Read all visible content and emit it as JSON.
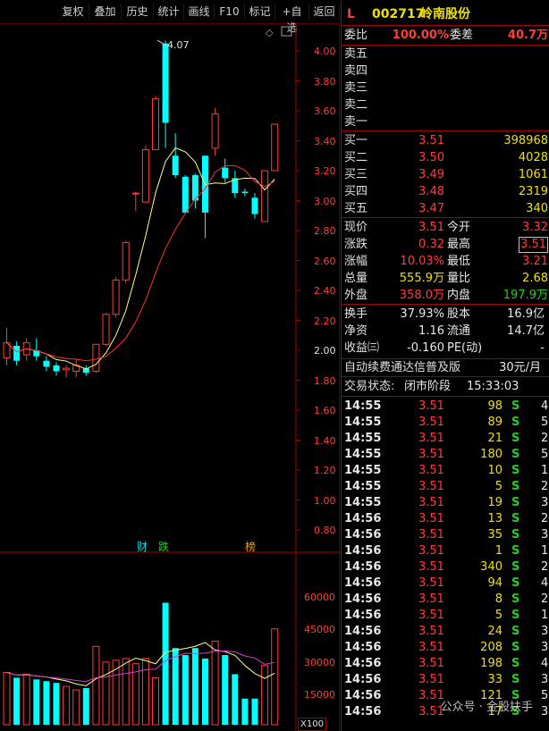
{
  "toolbar": {
    "items": [
      "复权",
      "叠加",
      "历史",
      "统计",
      "画线",
      "F10",
      "标记",
      "+自选",
      "返回"
    ]
  },
  "chart": {
    "price_labels": [
      "4.00",
      "3.80",
      "3.60",
      "3.40",
      "3.20",
      "3.00",
      "2.80",
      "2.60",
      "2.40",
      "2.20",
      "2.00",
      "1.80",
      "1.60",
      "1.40",
      "1.20",
      "1.00",
      "0.80"
    ],
    "high_label": "4.07",
    "events": [
      "财",
      "跌",
      "榜"
    ],
    "volume_labels": [
      "60000",
      "45000",
      "30000",
      "15000"
    ],
    "volume_unit": "X100"
  },
  "stock": {
    "flag": "L",
    "code": "002717",
    "name": "岭南股份"
  },
  "order": {
    "wei_bi_label": "委比",
    "wei_bi": "100.00%",
    "wei_cha_label": "委差",
    "wei_cha": "40.7万"
  },
  "sell": [
    "卖五",
    "卖四",
    "卖三",
    "卖二",
    "卖一"
  ],
  "buy": [
    {
      "label": "买一",
      "price": "3.51",
      "vol": "398968"
    },
    {
      "label": "买二",
      "price": "3.50",
      "vol": "4028"
    },
    {
      "label": "买三",
      "price": "3.49",
      "vol": "1061"
    },
    {
      "label": "买四",
      "price": "3.48",
      "vol": "2319"
    },
    {
      "label": "买五",
      "price": "3.47",
      "vol": "340"
    }
  ],
  "quote": [
    {
      "l1": "现价",
      "v1": "3.51",
      "l2": "今开",
      "v2": "3.32"
    },
    {
      "l1": "涨跌",
      "v1": "0.32",
      "l2": "最高",
      "v2": "3.51"
    },
    {
      "l1": "涨幅",
      "v1": "10.03%",
      "l2": "最低",
      "v2": "3.21"
    },
    {
      "l1": "总量",
      "v1": "555.9万",
      "l2": "量比",
      "v2": "2.68"
    },
    {
      "l1": "外盘",
      "v1": "358.0万",
      "l2": "内盘",
      "v2": "197.9万"
    }
  ],
  "fund": [
    {
      "l1": "换手",
      "v1": "37.93%",
      "l2": "股本",
      "v2": "16.9亿"
    },
    {
      "l1": "净资",
      "v1": "1.16",
      "l2": "流通",
      "v2": "14.7亿"
    },
    {
      "l1": "收益㈢",
      "v1": "-0.160",
      "l2": "PE(动)",
      "v2": "-"
    }
  ],
  "service": {
    "text": "自动续费通达信普及版",
    "price": "30元/月"
  },
  "status": {
    "label": "交易状态:",
    "value": "闭市阶段",
    "time": "15:33:03"
  },
  "ticks": [
    {
      "t": "14:55",
      "p": "3.51",
      "v": "98",
      "s": "S",
      "n": "4"
    },
    {
      "t": "14:55",
      "p": "3.51",
      "v": "89",
      "s": "S",
      "n": "5"
    },
    {
      "t": "14:55",
      "p": "3.51",
      "v": "21",
      "s": "S",
      "n": "2"
    },
    {
      "t": "14:55",
      "p": "3.51",
      "v": "180",
      "s": "S",
      "n": "5"
    },
    {
      "t": "14:55",
      "p": "3.51",
      "v": "10",
      "s": "S",
      "n": "1"
    },
    {
      "t": "14:55",
      "p": "3.51",
      "v": "5",
      "s": "S",
      "n": "2"
    },
    {
      "t": "14:55",
      "p": "3.51",
      "v": "19",
      "s": "S",
      "n": "3"
    },
    {
      "t": "14:56",
      "p": "3.51",
      "v": "13",
      "s": "S",
      "n": "2"
    },
    {
      "t": "14:56",
      "p": "3.51",
      "v": "35",
      "s": "S",
      "n": "3"
    },
    {
      "t": "14:56",
      "p": "3.51",
      "v": "1",
      "s": "S",
      "n": "1"
    },
    {
      "t": "14:56",
      "p": "3.51",
      "v": "340",
      "s": "S",
      "n": "2"
    },
    {
      "t": "14:56",
      "p": "3.51",
      "v": "94",
      "s": "S",
      "n": "4"
    },
    {
      "t": "14:56",
      "p": "3.51",
      "v": "8",
      "s": "S",
      "n": "2"
    },
    {
      "t": "14:56",
      "p": "3.51",
      "v": "5",
      "s": "S",
      "n": "1"
    },
    {
      "t": "14:56",
      "p": "3.51",
      "v": "24",
      "s": "S",
      "n": "3"
    },
    {
      "t": "14:56",
      "p": "3.51",
      "v": "208",
      "s": "S",
      "n": "3"
    },
    {
      "t": "14:56",
      "p": "3.51",
      "v": "198",
      "s": "S",
      "n": "4"
    },
    {
      "t": "14:56",
      "p": "3.51",
      "v": "33",
      "s": "S",
      "n": "3"
    },
    {
      "t": "14:56",
      "p": "3.51",
      "v": "121",
      "s": "S",
      "n": "5"
    },
    {
      "t": "14:56",
      "p": "3.51",
      "v": "17",
      "s": "S",
      "n": "3"
    }
  ],
  "watermark": "公众号 · 金股扶手",
  "colors": {
    "up": "#ff3c3c",
    "down": "#00ffff",
    "ma5": "#ffff80",
    "ma10": "#ff3030",
    "vol_ma": "#d040d0",
    "up_text": "#ff3c3c",
    "down_text": "#20d020"
  }
}
